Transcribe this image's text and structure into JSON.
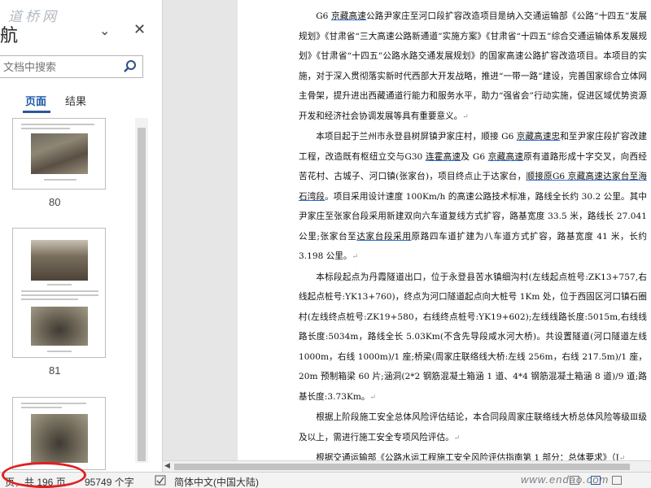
{
  "nav": {
    "title": "航",
    "watermark": "道桥网",
    "search": {
      "placeholder": "文档中搜索"
    },
    "tabs": {
      "headings_stub": "",
      "pages": "页面",
      "results": "结果"
    },
    "thumbnails": [
      {
        "label": "80"
      },
      {
        "label": "81"
      },
      {
        "label": ""
      }
    ]
  },
  "document": {
    "paragraphs": [
      [
        "G6 ",
        {
          "u": "京藏高速"
        },
        "公路尹家庄至河口段扩容改造项目是纳入交通运输部《公路“十四五”发展规划》《甘肃省“三大高速公路新通道”实施方案》《甘肃省“十四五”综合交通运输体系发展规划》《甘肃省“十四五”公路水路交通发展规划》的国家高速公路扩容改造项目。本项目的实施，对于深入贯彻落实新时代西部大开发战略，推进“一带一路”建设，完善国家综合立体网主骨架，提升进出西藏通道行能力和服务水平，助力“强省会”行动实施，促进区域优势资源开发和经济社会协调发展等具有重要意义。"
      ],
      [
        "本项目起于兰州市永登县树屏镇尹家庄村，顺接 G6 ",
        {
          "u": "京藏高速忠"
        },
        "和至尹家庄段扩容改建工程，改造既有枢纽立交与G30 ",
        {
          "u": "连霍高速"
        },
        "及 G6 ",
        {
          "u": "京藏高速"
        },
        "原有道路形成十字交叉，向西经苦花村、古城子、河口镇(张家台)，项目终点止于达家台，",
        {
          "u": "顺接原G6 京藏高速达家台至海石湾段"
        },
        "。项目采用设计速度 100Km/h 的高速公路技术标准，路线全长约 30.2 公里。其中尹家庄至张家台段采用新建双向六车道复线方式扩容，路基宽度 33.5 米，路线长 27.041 公里;张家台至",
        {
          "u": "达家台段采用"
        },
        "原路四车道扩建为八车道方式扩容，路基宽度 41 米，长约 3.198 公里。"
      ],
      [
        "本标段起点为丹霞隧道出口，位于永登县苦水镇细沟村(左线起点桩号:ZK13+757,右线起点桩号:YK13+760)，终点为河口隧道起点向大桩号 1Km 处，位于西固区河口镇石圈村(左线终点桩号:ZK19+580，右线终点桩号:YK19+602);左线线路长度:5015m,右线线路长度:5034m，路线全长 5.03Km(不含先导段咸水河大桥)。共设置隧道(河口隧道左线 1000m，右线 1000m)/1 座;桥梁(周家庄联络线大桥:左线 256m，右线 217.5m)/1 座，20m 预制箱梁 60 片;涵洞(2*2 钢筋混凝土箱涵 1 道、4*4 钢筋混凝土箱涵 8 道)/9 道;路基长度:3.73Km。"
      ],
      [
        "根据上阶段施工安全总体风险评估结论，本合同段周家庄联络线大桥总体风险等级Ⅲ级及以上，需进行施工安全专项风险评估。"
      ],
      [
        "根据交通运输部《公路水运工程施工安全风险评估指南第 1 部分：总体要求》（J"
      ]
    ],
    "para_mark": "↵"
  },
  "status": {
    "page": "页，共 196 页",
    "words": "95749 个字",
    "language": "简体中文(中国大陆)",
    "site_watermark": "www.endao.com"
  }
}
